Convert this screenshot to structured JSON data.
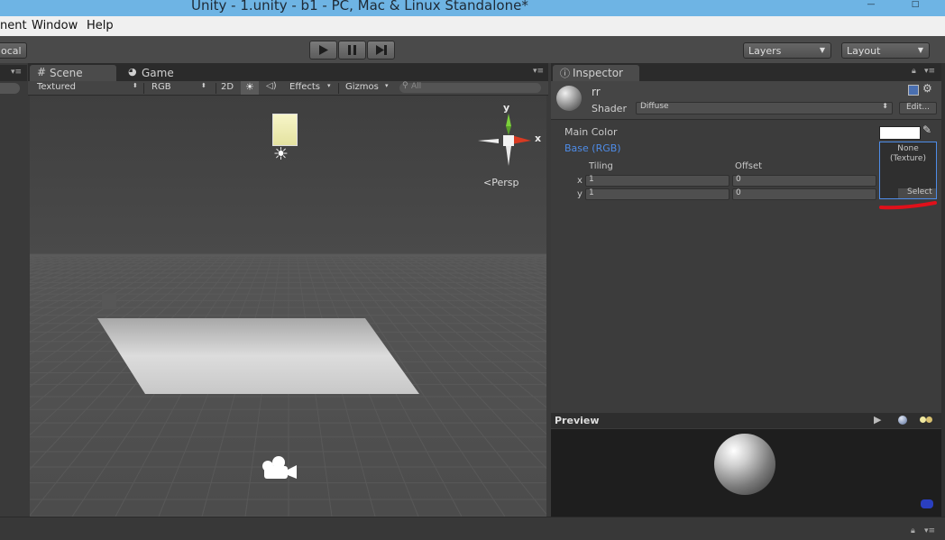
{
  "window": {
    "title": "Unity - 1.unity - b1 - PC, Mac & Linux Standalone*",
    "controls": [
      "—",
      "□"
    ]
  },
  "menu": [
    "nent",
    "Window",
    "Help"
  ],
  "toolbar": {
    "local_label": "ocal",
    "layers_label": "Layers",
    "layout_label": "Layout",
    "play_icon": "play-icon",
    "pause_icon": "pause-icon",
    "step_icon": "step-icon"
  },
  "scene_tabs": {
    "scene": "Scene",
    "game": "Game"
  },
  "scene_toolbar": {
    "render_mode": "Textured",
    "color_mode": "RGB",
    "mode_2d": "2D",
    "effects": "Effects",
    "gizmos": "Gizmos",
    "search_placeholder": "All"
  },
  "gizmo": {
    "y_label": "y",
    "x_label": "x",
    "persp_label": "Persp"
  },
  "inspector": {
    "tab_label": "Inspector",
    "material_name": "rr",
    "shader_label": "Shader",
    "shader_value": "Diffuse",
    "edit_button": "Edit...",
    "main_color_label": "Main Color",
    "base_label": "Base (RGB)",
    "tiling_label": "Tiling",
    "offset_label": "Offset",
    "x_label": "x",
    "y_label": "y",
    "tiling_x": "1",
    "tiling_y": "1",
    "offset_x": "0",
    "offset_y": "0",
    "texture_slot_line1": "None",
    "texture_slot_line2": "(Texture)",
    "select_button": "Select"
  },
  "preview": {
    "label": "Preview"
  },
  "colors": {
    "accent_blue": "#4e8ce8",
    "annotation_red": "#e0101a",
    "gizmo_y": "#7bd13a",
    "gizmo_x": "#d83a22"
  }
}
